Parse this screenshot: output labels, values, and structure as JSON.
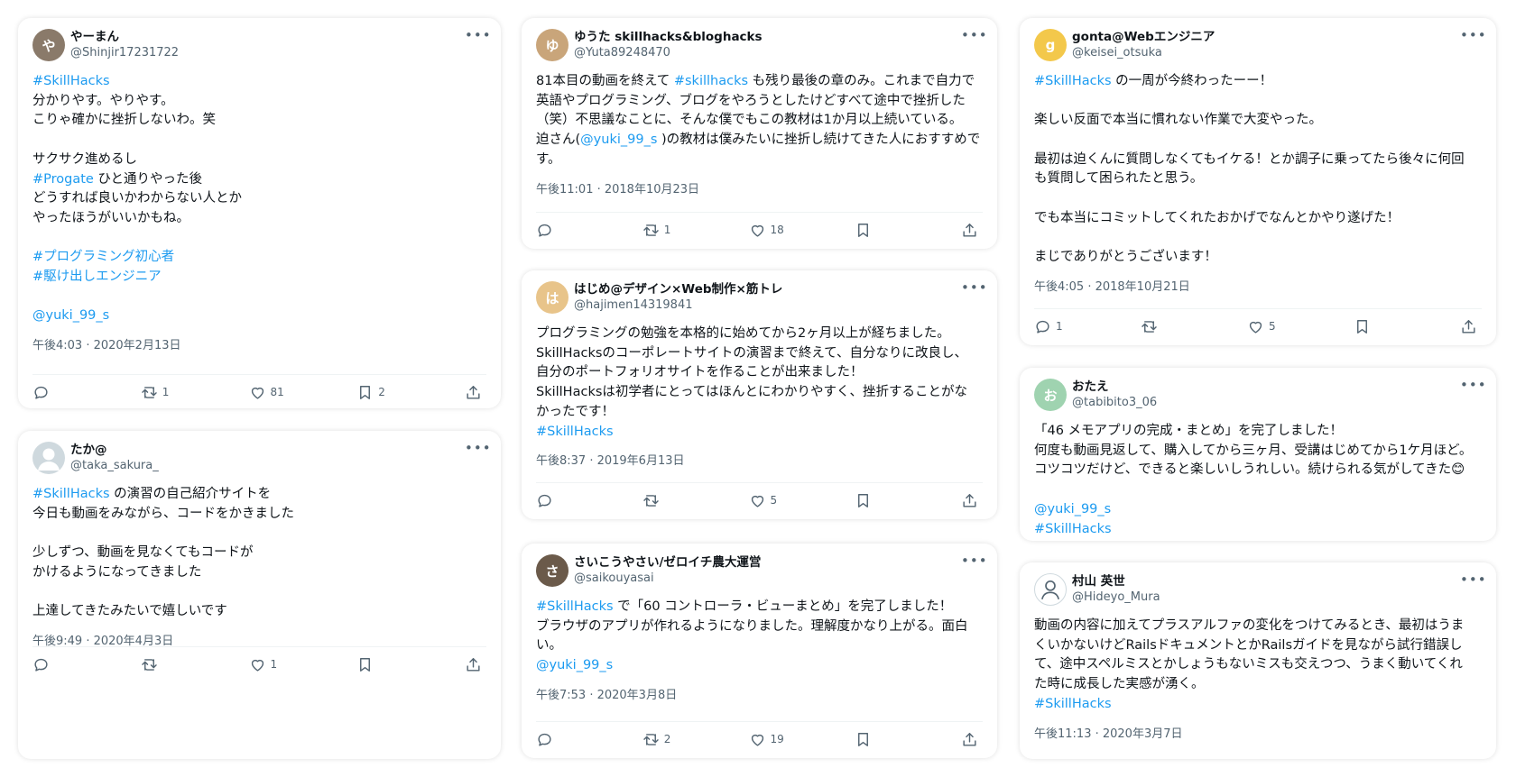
{
  "colors": {
    "link": "#1d9bf0",
    "muted": "#536471",
    "text": "#0f1419"
  },
  "icons": {
    "more": "more-dots-icon",
    "reply": "reply-icon",
    "retweet": "retweet-icon",
    "like": "heart-icon",
    "bookmark": "bookmark-icon",
    "share": "share-icon"
  },
  "tweets": [
    {
      "display_name": "やーまん",
      "handle": "@Shinjir17231722",
      "more": "•••",
      "timestamp": "午後4:03 · 2020年2月13日",
      "stats": {
        "reply": "",
        "retweet": "1",
        "like": "81",
        "bookmark": "2"
      }
    },
    {
      "display_name": "たか@",
      "handle": "@taka_sakura_",
      "more": "•••",
      "timestamp": "午後9:49 · 2020年4月3日",
      "stats": {
        "reply": "",
        "retweet": "",
        "like": "1",
        "bookmark": ""
      }
    },
    {
      "display_name": "ゆうた skillhacks&bloghacks",
      "handle": "@Yuta89248470",
      "more": "•••",
      "timestamp": "午後11:01 · 2018年10月23日",
      "stats": {
        "reply": "",
        "retweet": "1",
        "like": "18",
        "bookmark": ""
      }
    },
    {
      "display_name": "はじめ@デザイン×Web制作×筋トレ",
      "handle": "@hajimen14319841",
      "more": "•••",
      "timestamp": "午後8:37 · 2019年6月13日",
      "stats": {
        "reply": "",
        "retweet": "",
        "like": "5",
        "bookmark": ""
      }
    },
    {
      "display_name": "さいこうやさい/ゼロイチ農大運営",
      "handle": "@saikouyasai",
      "more": "•••",
      "timestamp": "午後7:53 · 2020年3月8日",
      "stats": {
        "reply": "",
        "retweet": "2",
        "like": "19",
        "bookmark": ""
      }
    },
    {
      "display_name": "gonta@Webエンジニア",
      "handle": "@keisei_otsuka",
      "more": "•••",
      "timestamp": "午後4:05 · 2018年10月21日",
      "stats": {
        "reply": "1",
        "retweet": "",
        "like": "5",
        "bookmark": ""
      }
    },
    {
      "display_name": "おたえ",
      "handle": "@tabibito3_06",
      "more": "•••",
      "timestamp": "",
      "stats": {}
    },
    {
      "display_name": "村山 英世",
      "handle": "@Hideyo_Mura",
      "more": "•••",
      "timestamp": "午後11:13 · 2020年3月7日",
      "stats": {}
    }
  ],
  "t0": {
    "l1": "#SkillHacks",
    "l2": "分かりやす。やりやす。",
    "l3": "こりゃ確かに挫折しないわ。笑",
    "l5": "サクサク進めるし",
    "l6a": "#Progate",
    "l6b": " ひと通りやった後",
    "l7": "どうすれば良いかわからない人とか",
    "l8": "やったほうがいいかもね。",
    "l10": "#プログラミング初心者",
    "l11": "#駆け出しエンジニア",
    "l13": "@yuki_99_s"
  },
  "t1": {
    "l1a": "#SkillHacks",
    "l1b": " の演習の自己紹介サイトを",
    "l2": "今日も動画をみながら、コードをかきました",
    "l4": "少しずつ、動画を見なくてもコードが",
    "l5": "かけるようになってきました",
    "l7": "上達してきたみたいで嬉しいです"
  },
  "t2": {
    "l1a": "81本目の動画を終えて ",
    "l1b": "#skillhacks",
    "l1c": " も残り最後の章のみ。これまで自力で",
    "l2": "英語やプログラミング、ブログをやろうとしたけどすべて途中で挫折した",
    "l3": "（笑）不思議なことに、そんな僕でもこの教材は1か月以上続いている。",
    "l4a": "迫さん(",
    "l4b": "@yuki_99_s",
    "l4c": " )の教材は僕みたいに挫折し続けてきた人におすすめで",
    "l5": "す。"
  },
  "t3": {
    "l1": "プログラミングの勉強を本格的に始めてから2ヶ月以上が経ちました。",
    "l2": "SkillHacksのコーポレートサイトの演習まで終えて、自分なりに改良し、",
    "l3": "自分のポートフォリオサイトを作ることが出来ました！",
    "l4": "SkillHacksは初学者にとってはほんとにわかりやすく、挫折することがな",
    "l5": "かったです！",
    "l6": "#SkillHacks"
  },
  "t4": {
    "l1a": "#SkillHacks",
    "l1b": " で「60 コントローラ・ビューまとめ」を完了しました！",
    "l2": "ブラウザのアプリが作れるようになりました。理解度かなり上がる。面白",
    "l3": "い。",
    "l4": "@yuki_99_s"
  },
  "t5": {
    "l1a": "#SkillHacks",
    "l1b": " の一周が今終わったーー！",
    "l3": "楽しい反面で本当に慣れない作業で大変やった。",
    "l5": "最初は迫くんに質問しなくてもイケる！とか調子に乗ってたら後々に何回",
    "l6": "も質問して困られたと思う。",
    "l8": "でも本当にコミットしてくれたおかげでなんとかやり遂げた！",
    "l10": "まじでありがとうございます！"
  },
  "t6": {
    "l1": "「46 メモアプリの完成・まとめ」を完了しました！",
    "l2": "何度も動画見返して、購入してから三ヶ月、受講はじめてから1ケ月ほど。",
    "l3": "コツコツだけど、できると楽しいしうれしい。続けられる気がしてきた😊",
    "l5": "@yuki_99_s",
    "l6": " #SkillHacks"
  },
  "t7": {
    "l1": "動画の内容に加えてプラスアルファの変化をつけてみるとき、最初はうま",
    "l2": "くいかないけどRailsドキュメントとかRailsガイドを見ながら試行錯誤し",
    "l3": "て、途中スペルミスとかしょうもないミスも交えつつ、うまく動いてくれ",
    "l4": "た時に成長した実感が湧く。",
    "l5": "#SkillHacks"
  }
}
